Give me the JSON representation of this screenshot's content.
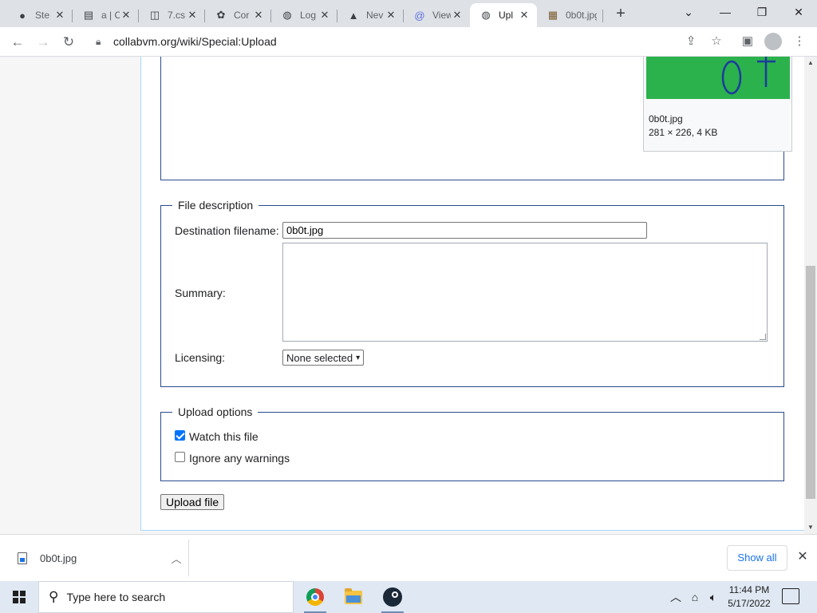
{
  "tabs": [
    {
      "title": "Ste",
      "icon": "steam-icon"
    },
    {
      "title": "a | C",
      "icon": "clipboard-icon"
    },
    {
      "title": "7.cs",
      "icon": "image-icon"
    },
    {
      "title": "Cor",
      "icon": "settings-icon"
    },
    {
      "title": "Log",
      "icon": "globe-icon"
    },
    {
      "title": "Nev",
      "icon": "neocities-icon"
    },
    {
      "title": "View",
      "icon": "at-icon"
    },
    {
      "title": "Upl",
      "icon": "globe-icon"
    },
    {
      "title": "0b0t.jpg",
      "icon": "photo-icon"
    }
  ],
  "toolbar": {
    "url": "collabvm.org/wiki/Special:Upload"
  },
  "page": {
    "thumbnail": {
      "filename": "0b0t.jpg",
      "meta": "281 × 226, 4 KB",
      "image_text": "0 †"
    },
    "file_description": {
      "legend": "File description",
      "dest_label": "Destination filename:",
      "dest_value": "0b0t.jpg",
      "summary_label": "Summary:",
      "licensing_label": "Licensing:",
      "licensing_value": "None selected"
    },
    "upload_options": {
      "legend": "Upload options",
      "watch_label": "Watch this file",
      "watch_checked": true,
      "ignore_label": "Ignore any warnings",
      "ignore_checked": false
    },
    "upload_button": "Upload file"
  },
  "downloads": {
    "file_name": "0b0t.jpg",
    "show_all": "Show all"
  },
  "taskbar": {
    "search_placeholder": "Type here to search",
    "time": "11:44 PM",
    "date": "5/17/2022"
  }
}
